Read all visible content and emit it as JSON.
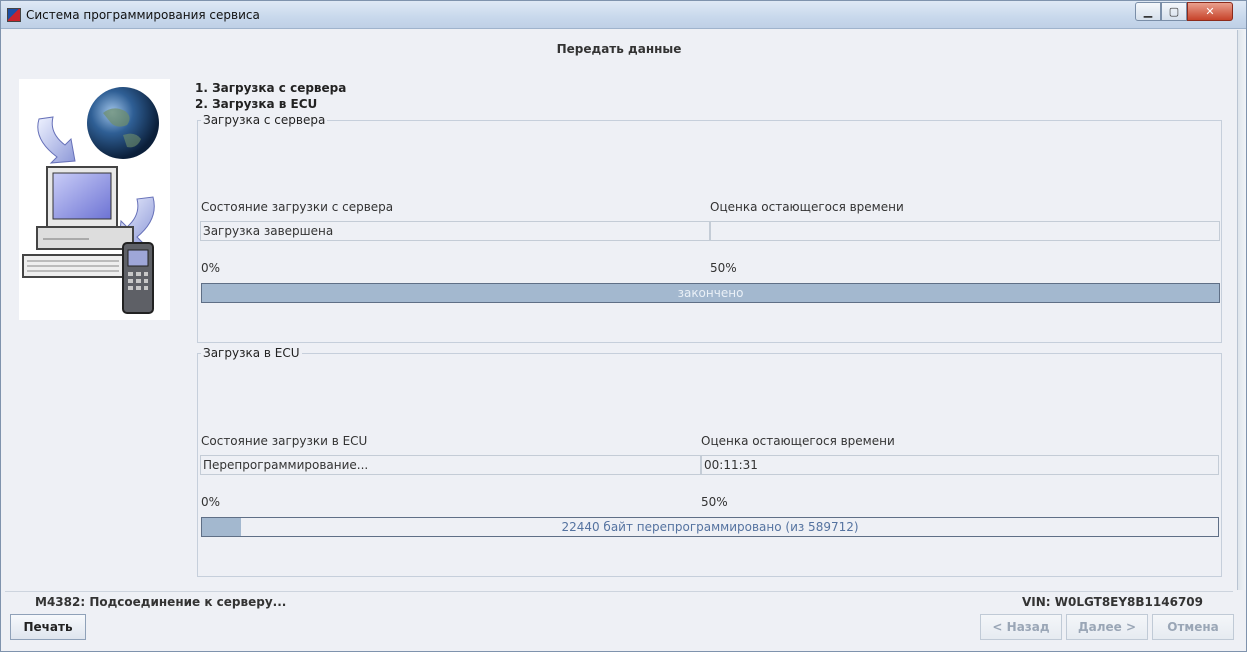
{
  "window": {
    "title": "Система программирования сервиса",
    "controls": {
      "minimize": "▁",
      "maximize": "▢",
      "close": "✕"
    }
  },
  "page": {
    "heading": "Передать данные",
    "steps": [
      "1. Загрузка с сервера",
      "2. Загрузка в ECU"
    ]
  },
  "server_group": {
    "legend": "Загрузка с сервера",
    "status_label": "Состояние загрузки с сервера",
    "status_value": "Загрузка завершена",
    "time_label": "Оценка остающегося времени",
    "time_value": "",
    "scale_start": "0%",
    "scale_mid": "50%",
    "progress_fraction": 1.0,
    "progress_text": "закончено"
  },
  "ecu_group": {
    "legend": "Загрузка в ECU",
    "status_label": "Состояние загрузки в ECU",
    "status_value": "Перепрограммирование...",
    "time_label": "Оценка остающегося времени",
    "time_value": "00:11:31",
    "scale_start": "0%",
    "scale_mid": "50%",
    "progress_fraction": 0.038,
    "progress_text": "22440 байт перепрограммировано (из 589712)"
  },
  "status_bar": {
    "message": "M4382: Подсоединение к серверу...",
    "vin": "VIN: W0LGT8EY8B1146709"
  },
  "buttons": {
    "print": "Печать",
    "back": "< Назад",
    "next": "Далее >",
    "cancel": "Отмена"
  },
  "colors": {
    "progress_fill": "#a3b8cf",
    "progress_text": "#5573a0",
    "close_button": "#c7432a"
  }
}
